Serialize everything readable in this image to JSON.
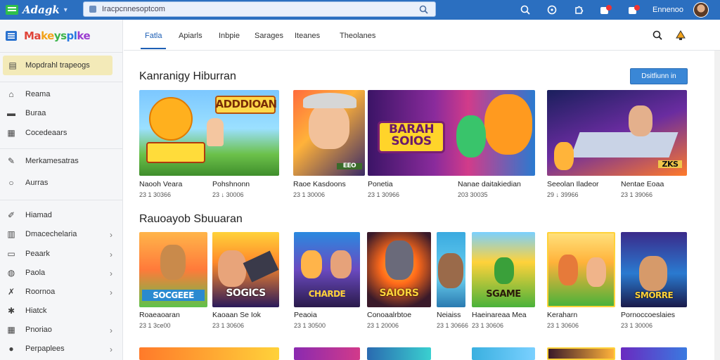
{
  "topbar": {
    "app_title": "Adagk",
    "search_query": "Iracpcnnesoptcom",
    "user_name": "Ennenoo",
    "icons": [
      "search-icon",
      "compass-icon",
      "puzzle-icon",
      "notification-icon",
      "gift-icon"
    ]
  },
  "sidebar": {
    "brand": [
      "Ma",
      "ke",
      "ys",
      "pl",
      "ke"
    ],
    "active_label": "Mopdrahl trapeogs",
    "items": [
      {
        "label": "Reama",
        "icon": "home-icon",
        "chevron": false
      },
      {
        "label": "Buraa",
        "icon": "library-icon",
        "chevron": false
      },
      {
        "label": "Cocedeaars",
        "icon": "calendar-icon",
        "chevron": false
      },
      {
        "label": "Merkamesatras",
        "icon": "link-icon",
        "chevron": false
      },
      {
        "label": "Aurras",
        "icon": "circle-icon",
        "chevron": false
      },
      {
        "label": "Hiamad",
        "icon": "tag-icon",
        "chevron": false
      },
      {
        "label": "Dmacechelaria",
        "icon": "chart-icon",
        "chevron": true
      },
      {
        "label": "Peaark",
        "icon": "folder-icon",
        "chevron": true
      },
      {
        "label": "Paola",
        "icon": "globe-icon",
        "chevron": true
      },
      {
        "label": "Roornoa",
        "icon": "tools-icon",
        "chevron": true
      },
      {
        "label": "Hiatck",
        "icon": "star-icon",
        "chevron": false
      },
      {
        "label": "Pnoriao",
        "icon": "grid-icon",
        "chevron": true
      },
      {
        "label": "Perpaplees",
        "icon": "people-icon",
        "chevron": true
      }
    ]
  },
  "tabs": [
    "Fatla",
    "Apiarls",
    "Inbpie",
    "Sarages",
    "Iteanes",
    "Theolanes"
  ],
  "section1": {
    "title": "Kanranigy Hiburran",
    "cta": "Dsitfiunn in",
    "cards": [
      {
        "name": "Naooh Veara",
        "sub": "23 1 30366",
        "title": "ADDDIOAN"
      },
      {
        "name": "Pohshnonn",
        "sub": "23 ↓ 30006",
        "title": ""
      },
      {
        "name": "Raoe Kasdoons",
        "sub": "23 1 30006",
        "title": "EEO"
      },
      {
        "name": "Ponetia",
        "sub": "23 1 30966",
        "title": "BARAH SOIOS"
      },
      {
        "name": "Nanae daitakiedian",
        "sub": "203 30035",
        "title": ""
      },
      {
        "name": "Seeolan Iladeor",
        "sub": "29 ↓ 39966",
        "title": ""
      },
      {
        "name": "Nentae Eoaa",
        "sub": "23 1 39066",
        "title": "ZKS"
      }
    ]
  },
  "section2": {
    "title": "Rauoayob Sbuuaran",
    "cards": [
      {
        "name": "Roaeaoaran",
        "sub": "23 1 3ce00",
        "title": "SOCGEEE"
      },
      {
        "name": "Kaoaan Se Iok",
        "sub": "23 1 30606",
        "title": "SOGICS"
      },
      {
        "name": "Peaoia",
        "sub": "23 1 30500",
        "title": "CHARDE"
      },
      {
        "name": "Conoaalrbtoe",
        "sub": "23 1 20006",
        "title": "SAIORS"
      },
      {
        "name": "Neiaiss",
        "sub": "23 1 30666",
        "title": ""
      },
      {
        "name": "Haeinareaa Mea",
        "sub": "23 1 30606",
        "title": "SGAME"
      },
      {
        "name": "Keraharn",
        "sub": "23 1 30606",
        "title": ""
      },
      {
        "name": "Pornoccoeslaies",
        "sub": "23 1 30006",
        "title": "SMORRE"
      }
    ]
  },
  "colors": {
    "topbar": "#2b6fc0",
    "accent": "#1d5fb5",
    "cta": "#3a87d6",
    "sidebar_active": "#f3eab8"
  }
}
